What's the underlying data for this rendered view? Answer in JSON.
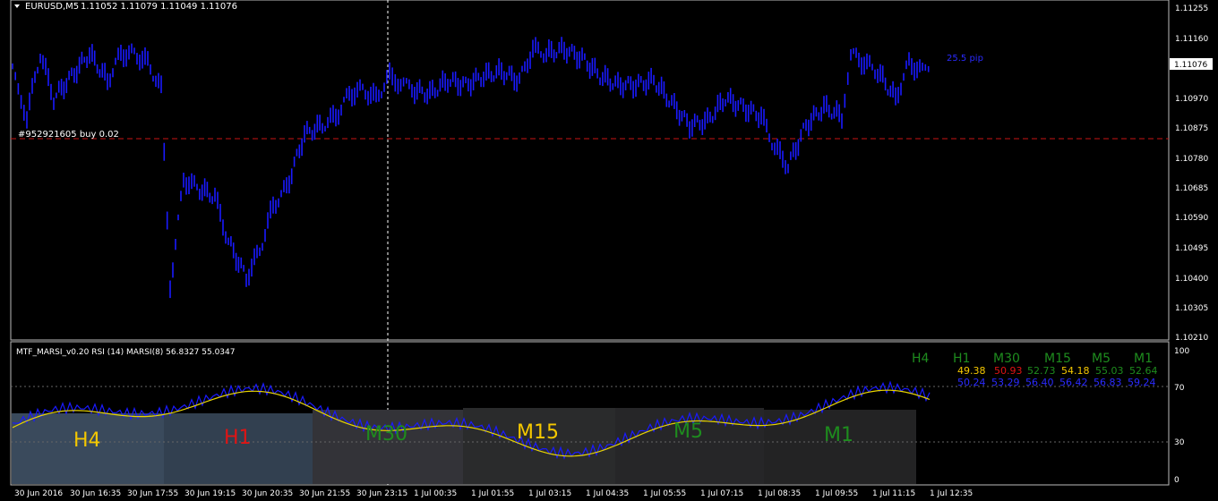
{
  "chart_header": {
    "symbol_label": "EURUSD,M5",
    "ohlc_label": "1.11052 1.11079 1.11049 1.11076"
  },
  "price_axis": {
    "labels": [
      "1.11255",
      "1.11160",
      "1.10970",
      "1.10875",
      "1.10780",
      "1.10685",
      "1.10590",
      "1.10495",
      "1.10400",
      "1.10305",
      "1.10210"
    ],
    "current_price": "1.11076"
  },
  "order_line": {
    "label": "#952921605 buy 0.02"
  },
  "spread_label": "25.5 pip",
  "time_axis": {
    "labels": [
      "30 Jun 2016",
      "30 Jun 16:35",
      "30 Jun 17:55",
      "30 Jun 19:15",
      "30 Jun 20:35",
      "30 Jun 21:55",
      "30 Jun 23:15",
      "1 Jul 00:35",
      "1 Jul 01:55",
      "1 Jul 03:15",
      "1 Jul 04:35",
      "1 Jul 05:55",
      "1 Jul 07:15",
      "1 Jul 08:35",
      "1 Jul 09:55",
      "1 Jul 11:15",
      "1 Jul 12:35"
    ]
  },
  "indicator": {
    "header_label": "MTF_MARSI_v0.20  RSI (14)  MARSI(8) 56.8327 55.0347",
    "scale_labels": [
      "100",
      "70",
      "30",
      "0"
    ],
    "timeframes": [
      {
        "name": "H4",
        "rsi": "",
        "marsi": ""
      },
      {
        "name": "H1",
        "rsi": "49.38",
        "marsi": "50.24"
      },
      {
        "name": "M30",
        "rsi": "50.93",
        "marsi": "53.29"
      },
      {
        "name": "M15",
        "rsi": "52.73",
        "marsi": "56.40"
      },
      {
        "name": "M5",
        "rsi": "54.18",
        "marsi": "56.42"
      },
      {
        "name": "M1",
        "rsi": "55.03",
        "marsi": "56.83"
      },
      {
        "name": "",
        "rsi": "52.64",
        "marsi": "59.24"
      }
    ],
    "zone_labels": [
      "H4",
      "H1",
      "M30",
      "M15",
      "M5",
      "M1"
    ]
  },
  "colors": {
    "candles": "#1a1aff",
    "marsi_line": "#e8d400",
    "order_line": "#c81414",
    "label_green": "#1e8c1e",
    "label_yellow": "#f5c800",
    "label_red": "#e01414",
    "label_blue": "#2a2aff"
  }
}
